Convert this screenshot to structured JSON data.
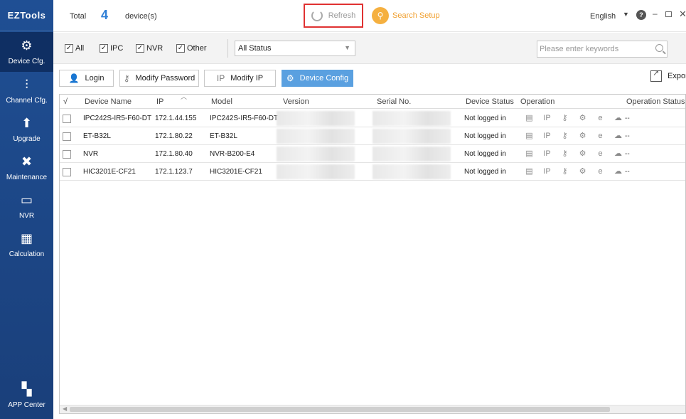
{
  "app": {
    "title": "EZTools"
  },
  "sidebar": {
    "items": [
      {
        "label": "Device Cfg.",
        "icon": "gear-icon",
        "glyph": "⚙"
      },
      {
        "label": "Channel Cfg.",
        "icon": "sliders-icon",
        "glyph": "⫶"
      },
      {
        "label": "Upgrade",
        "icon": "upgrade-icon",
        "glyph": "⬆"
      },
      {
        "label": "Maintenance",
        "icon": "tools-icon",
        "glyph": "✖"
      },
      {
        "label": "NVR",
        "icon": "nvr-icon",
        "glyph": "▭"
      },
      {
        "label": "Calculation",
        "icon": "calculator-icon",
        "glyph": "▦"
      },
      {
        "label": "APP Center",
        "icon": "app-grid-icon",
        "glyph": "▚"
      }
    ]
  },
  "header": {
    "total_label": "Total",
    "total_count": "4",
    "device_unit": "device(s)",
    "refresh_label": "Refresh",
    "search_setup_label": "Search Setup",
    "language": "English"
  },
  "filters": {
    "checkboxes": [
      {
        "label": "All",
        "checked": true
      },
      {
        "label": "IPC",
        "checked": true
      },
      {
        "label": "NVR",
        "checked": true
      },
      {
        "label": "Other",
        "checked": true
      }
    ],
    "status_selected": "All Status",
    "keyword_placeholder": "Please enter keywords"
  },
  "toolbar": {
    "login": "Login",
    "modify_password": "Modify Password",
    "modify_ip": "Modify IP",
    "device_config": "Device Config",
    "export": "Export"
  },
  "table": {
    "columns": [
      "√",
      "Device Name",
      "IP",
      "Model",
      "Version",
      "Serial No.",
      "Device Status",
      "Operation",
      "Operation Status"
    ],
    "rows": [
      {
        "name": "IPC242S-IR5-F60-DT",
        "ip": "172.1.44.155",
        "model": "IPC242S-IR5-F60-DT",
        "status": "Not logged in",
        "op_status": "--"
      },
      {
        "name": "ET-B32L",
        "ip": "172.1.80.22",
        "model": "ET-B32L",
        "status": "Not logged in",
        "op_status": "--"
      },
      {
        "name": "NVR",
        "ip": "172.1.80.40",
        "model": "NVR-B200-E4",
        "status": "Not logged in",
        "op_status": "--"
      },
      {
        "name": "HIC3201E-CF21",
        "ip": "172.1.123.7",
        "model": "HIC3201E-CF21",
        "status": "Not logged in",
        "op_status": "--"
      }
    ],
    "operation_icons": [
      "config-file-icon",
      "ip-icon",
      "key-icon",
      "settings-icon",
      "browser-icon",
      "cloud-icon"
    ]
  },
  "colors": {
    "sidebar": "#1f4f94",
    "accent": "#2f7fd6",
    "primary_button": "#5aa0e0",
    "highlight_border": "#e03232",
    "search_setup": "#f0a030"
  }
}
